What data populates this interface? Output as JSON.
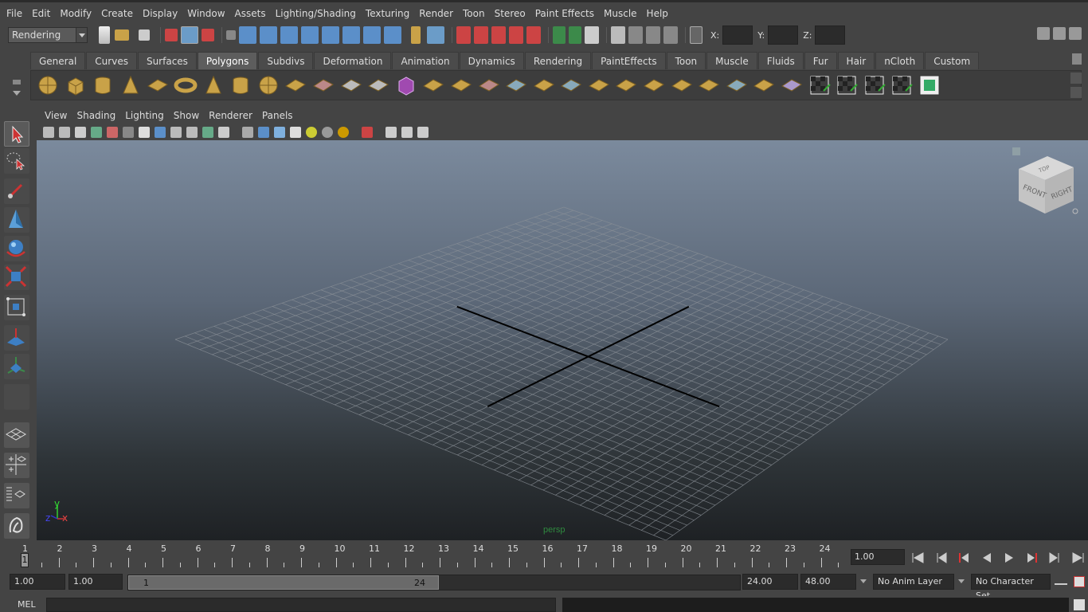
{
  "menu": [
    "File",
    "Edit",
    "Modify",
    "Create",
    "Display",
    "Window",
    "Assets",
    "Lighting/Shading",
    "Texturing",
    "Render",
    "Toon",
    "Stereo",
    "Paint Effects",
    "Muscle",
    "Help"
  ],
  "status": {
    "mode": "Rendering",
    "x_label": "X:",
    "y_label": "Y:",
    "z_label": "Z:",
    "x_value": "",
    "y_value": "",
    "z_value": ""
  },
  "shelf": {
    "tabs": [
      "General",
      "Curves",
      "Surfaces",
      "Polygons",
      "Subdivs",
      "Deformation",
      "Animation",
      "Dynamics",
      "Rendering",
      "PaintEffects",
      "Toon",
      "Muscle",
      "Fluids",
      "Fur",
      "Hair",
      "nCloth",
      "Custom"
    ],
    "active": "Polygons",
    "icons": [
      "poly-sphere-icon",
      "poly-cube-icon",
      "poly-cylinder-icon",
      "poly-cone-icon",
      "poly-plane-icon",
      "poly-torus-icon",
      "poly-pyramid-icon",
      "poly-pipe-icon",
      "poly-soccer-ball-icon",
      "poly-helix-icon",
      "combine-icon",
      "separate-icon",
      "smooth-icon",
      "bevel-icon",
      "extrude-icon",
      "bridge-icon",
      "append-polygon-icon",
      "split-polygon-icon",
      "insert-edge-loop-icon",
      "wedge-face-icon",
      "merge-icon",
      "merge-to-center-icon",
      "collapse-icon",
      "delete-edge-icon",
      "poke-icon",
      "duplicate-face-icon",
      "extract-icon",
      "soft-select-icon",
      "planar-mapping-icon",
      "cylindrical-mapping-icon",
      "spherical-mapping-icon",
      "automatic-mapping-icon",
      "uv-texture-editor-icon"
    ]
  },
  "panel": {
    "menus": [
      "View",
      "Shading",
      "Lighting",
      "Show",
      "Renderer",
      "Panels"
    ],
    "viewport_label": "persp",
    "cube_faces": {
      "top": "TOP",
      "front": "FRONT",
      "right": "RIGHT"
    },
    "axis": {
      "x": "x",
      "y": "y",
      "z": "z"
    }
  },
  "timeline": {
    "ticks": [
      1,
      2,
      3,
      4,
      5,
      6,
      7,
      8,
      9,
      10,
      11,
      12,
      13,
      14,
      15,
      16,
      17,
      18,
      19,
      20,
      21,
      22,
      23,
      24
    ],
    "current": "1",
    "current_frame_field": "1.00"
  },
  "range": {
    "start_time": "1.00",
    "start_playback": "1.00",
    "handle_start": "1",
    "handle_end": "24",
    "end_playback": "24.00",
    "end_time": "48.00",
    "anim_layer": "No Anim Layer",
    "character_set": "No Character Set"
  },
  "cmd": {
    "label": "MEL"
  },
  "colors": {
    "bg": "#444444",
    "viewport_top": "#7b8a9d",
    "viewport_bottom": "#1e2124",
    "grid": "#8a9097",
    "axis": "#000000"
  }
}
